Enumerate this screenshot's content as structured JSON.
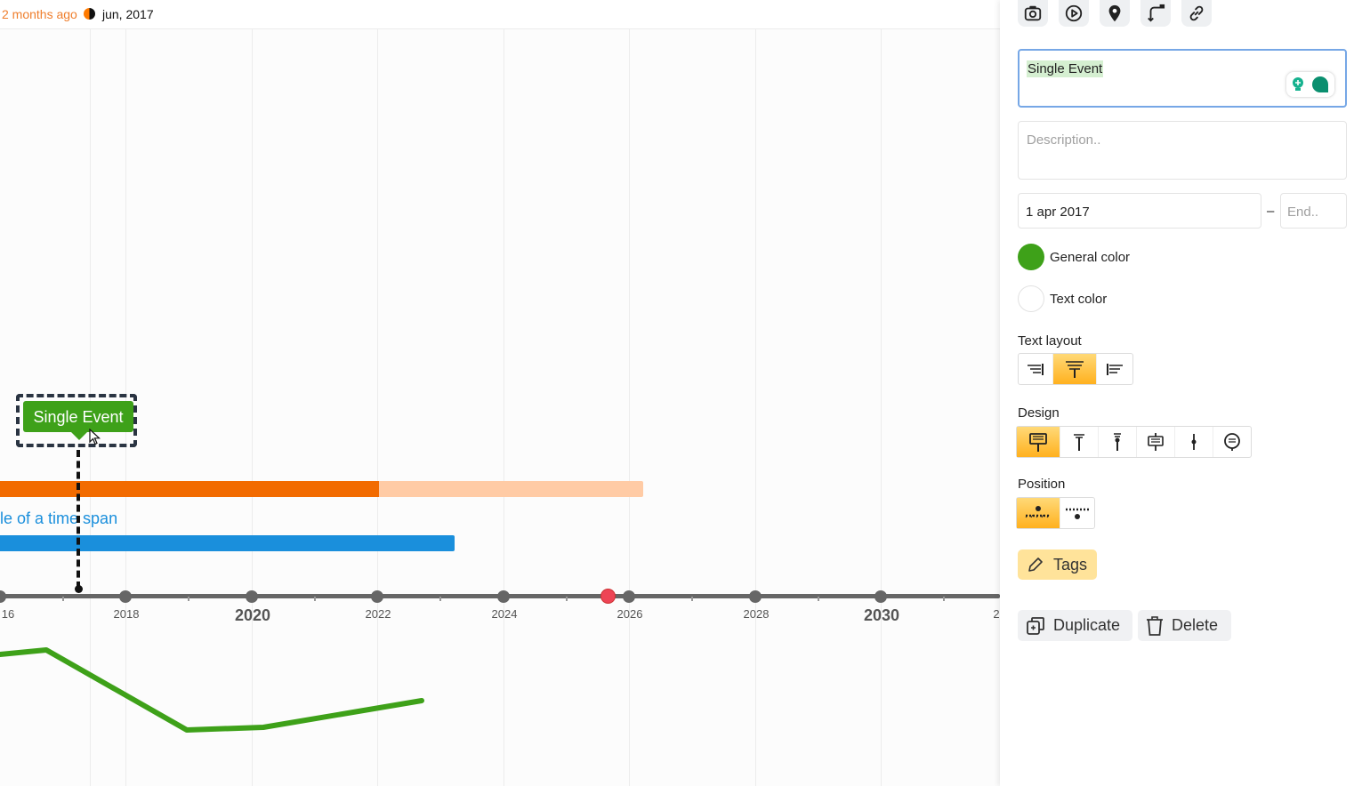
{
  "topbar": {
    "relative_time": "2 months ago",
    "current_date": "jun, 2017"
  },
  "axis": {
    "years": [
      "16",
      "2018",
      "2020",
      "2022",
      "2024",
      "2026",
      "2028",
      "2030",
      "2"
    ],
    "major_years": [
      "2020",
      "2030"
    ]
  },
  "event": {
    "label": "Single Event",
    "color": "#3ea119"
  },
  "time_spans": [
    {
      "color": "#f26b00",
      "faded_color": "#ffcba5"
    },
    {
      "label": "le of a time span",
      "color": "#1a8fdc"
    }
  ],
  "colors": {
    "today_marker": "#ee4455",
    "axis": "#666666",
    "series": "#3ea119"
  },
  "panel": {
    "toolbar": [
      "camera-icon",
      "play-icon",
      "location-pin-icon",
      "move-icon",
      "link-icon"
    ],
    "title_value": "Single Event",
    "description_placeholder": "Description..",
    "start_date": "1 apr 2017",
    "date_separator": "–",
    "end_placeholder": "End..",
    "general_color_label": "General color",
    "general_color": "#3ea119",
    "text_color_label": "Text color",
    "text_layout_label": "Text layout",
    "design_label": "Design",
    "position_label": "Position",
    "tags_label": "Tags",
    "duplicate_label": "Duplicate",
    "delete_label": "Delete"
  }
}
